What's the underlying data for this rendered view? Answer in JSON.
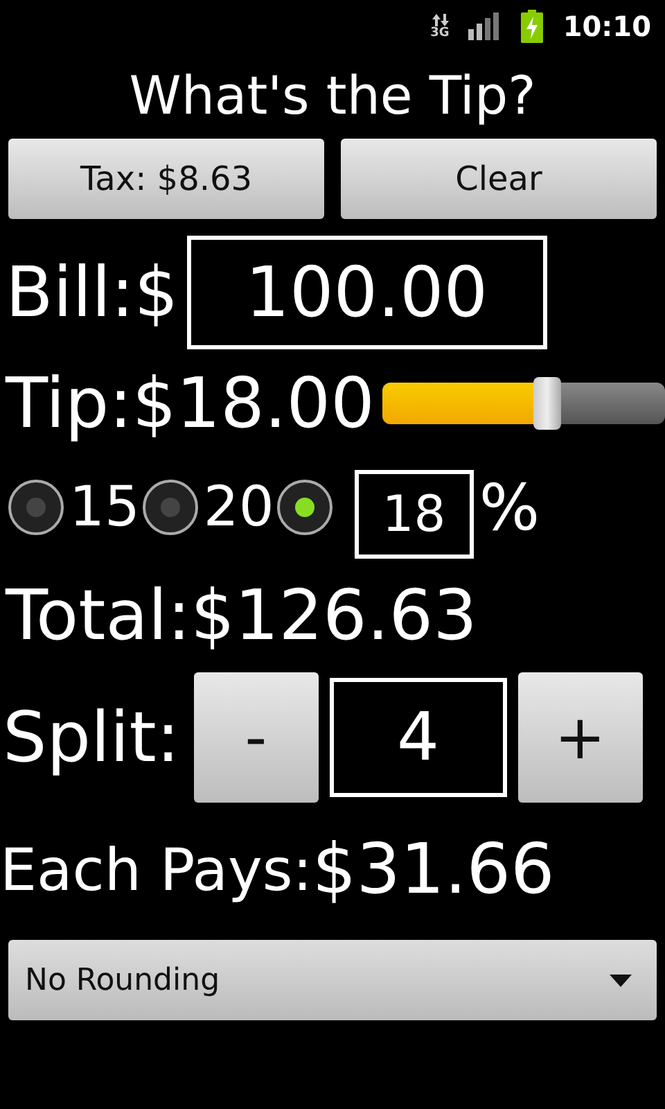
{
  "status_bar": {
    "network": "3G",
    "time": "10:10"
  },
  "title": "What's the Tip?",
  "buttons": [
    {
      "label": "Tax: $8.63"
    },
    {
      "label": "Clear"
    }
  ],
  "bill": {
    "label": "Bill:$",
    "value": "100.00"
  },
  "tip": {
    "label": "Tip:$18.00",
    "level": 0.58
  },
  "tip_options": [
    {
      "label": "15",
      "selected": false
    },
    {
      "label": "20",
      "selected": false
    }
  ],
  "custom_tip": {
    "selected": true,
    "value": "18",
    "suffix": "%"
  },
  "total": "Total:$126.63",
  "split": {
    "label": "Split:",
    "minus": "-",
    "value": "4",
    "plus": "+"
  },
  "each_pays": {
    "label": "Each Pays:",
    "amount": "$31.66"
  },
  "rounding": {
    "value": "No Rounding"
  }
}
